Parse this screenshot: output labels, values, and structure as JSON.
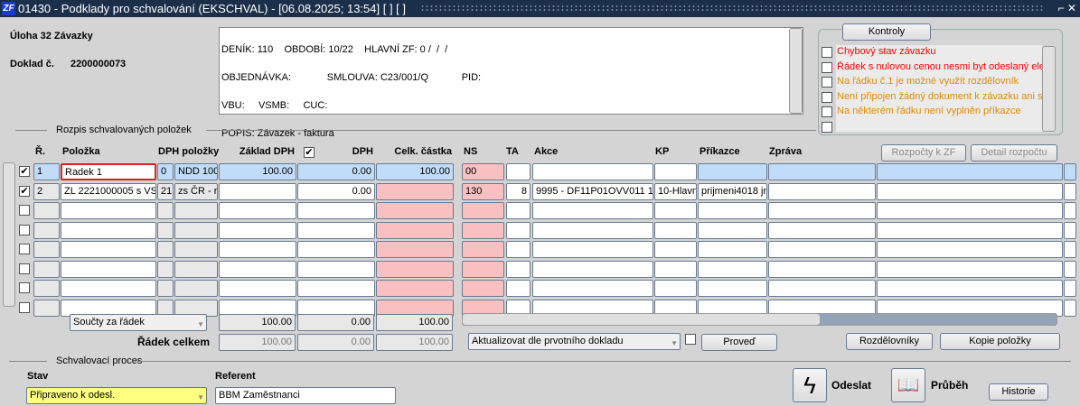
{
  "window": {
    "title": "01430 - Podklady pro schvalování (EKSCHVAL) - [06.08.2025; 13:54]  [ ]  [ ]",
    "logo": "ZF",
    "controls": "⌐ ✕"
  },
  "header": {
    "task": "Úloha 32 Závazky",
    "doc_label": "Doklad č.",
    "doc_number": "2200000073",
    "info_lines": [
      "DENÍK: 110    OBDOBÍ: 10/22    HLAVNÍ ZF: 0 /  /  /",
      "OBJEDNÁVKA:             SMLOUVA: C23/001/Q            PID:",
      "VBU:     VSMB:     CUC:",
      "POPIS: Závazek - faktura"
    ]
  },
  "kontroly": {
    "title": "Kontroly",
    "items": [
      {
        "text": "Chybový stav závazku",
        "color": "#ff0000"
      },
      {
        "text": "Řádek s nulovou cenou nesmi byt odeslaný ele",
        "color": "#ff0000"
      },
      {
        "text": "Na řádku č.1 je možné využít rozdělovník",
        "color": "#e08a00"
      },
      {
        "text": "Není připojen žádný dokument k závazku ani sc",
        "color": "#e08a00"
      },
      {
        "text": "Na některém řádku není vyplněn příkazce",
        "color": "#e08a00"
      },
      {
        "text": "",
        "color": "#000"
      }
    ]
  },
  "items_section": {
    "title": "Rozpis schvalovaných položek",
    "columns": {
      "r": "Ř.",
      "polozka": "Položka",
      "dph_polozky": "DPH položky",
      "zaklad": "Základ DPH",
      "dph": "DPH",
      "celk": "Celk. částka",
      "ns": "NS",
      "ta": "TA",
      "akce": "Akce",
      "kp": "KP",
      "prikazce": "Příkazce",
      "zprava": "Zpráva"
    },
    "buttons": {
      "rozpocty": "Rozpočty k ZF",
      "detail": "Detail rozpočtu"
    },
    "rows": [
      {
        "checked": true,
        "r": "1",
        "polozka": "Radek 1",
        "dph": "0",
        "dph_polozky": "NDD 100",
        "zaklad": "100.00",
        "dph_val": "0.00",
        "celk": "100.00",
        "ns": "00",
        "ta": "",
        "akce": "",
        "kp": "",
        "prikazce": "",
        "zprava": "",
        "extra": ""
      },
      {
        "checked": true,
        "r": "2",
        "polozka": "ZL 2221000005 s VS",
        "dph": "21",
        "dph_polozky": "zs ČR - r",
        "zaklad": "",
        "dph_val": "0.00",
        "celk": "",
        "ns": "130",
        "ta": "8",
        "akce": "9995 -  DF11P01OVV011 1",
        "kp": "10-Hlavn",
        "prikazce": "prijmeni4018 jm",
        "zprava": "",
        "extra": ""
      },
      {
        "checked": false
      },
      {
        "checked": false
      },
      {
        "checked": false
      },
      {
        "checked": false
      },
      {
        "checked": false
      },
      {
        "checked": false
      }
    ],
    "sum_select": "Součty za řádek",
    "sums": {
      "zaklad": "100.00",
      "dph": "0.00",
      "celk": "100.00"
    },
    "total_label": "Řádek celkem",
    "totals": {
      "zaklad": "100.00",
      "dph": "0.00",
      "celk": "100.00"
    },
    "update_select": "Aktualizovat dle prvotního dokladu",
    "proved": "Proveď",
    "rozdelovniky": "Rozdělovníky",
    "kopie": "Kopie položky"
  },
  "process": {
    "title": "Schvalovací proces",
    "stav_label": "Stav",
    "stav_value": "Připraveno k odesl.",
    "referent_label": "Referent",
    "referent_value": "BBM Zaměstnanci",
    "odeslat": "Odeslat",
    "prubeh": "Průběh",
    "historie": "Historie"
  }
}
